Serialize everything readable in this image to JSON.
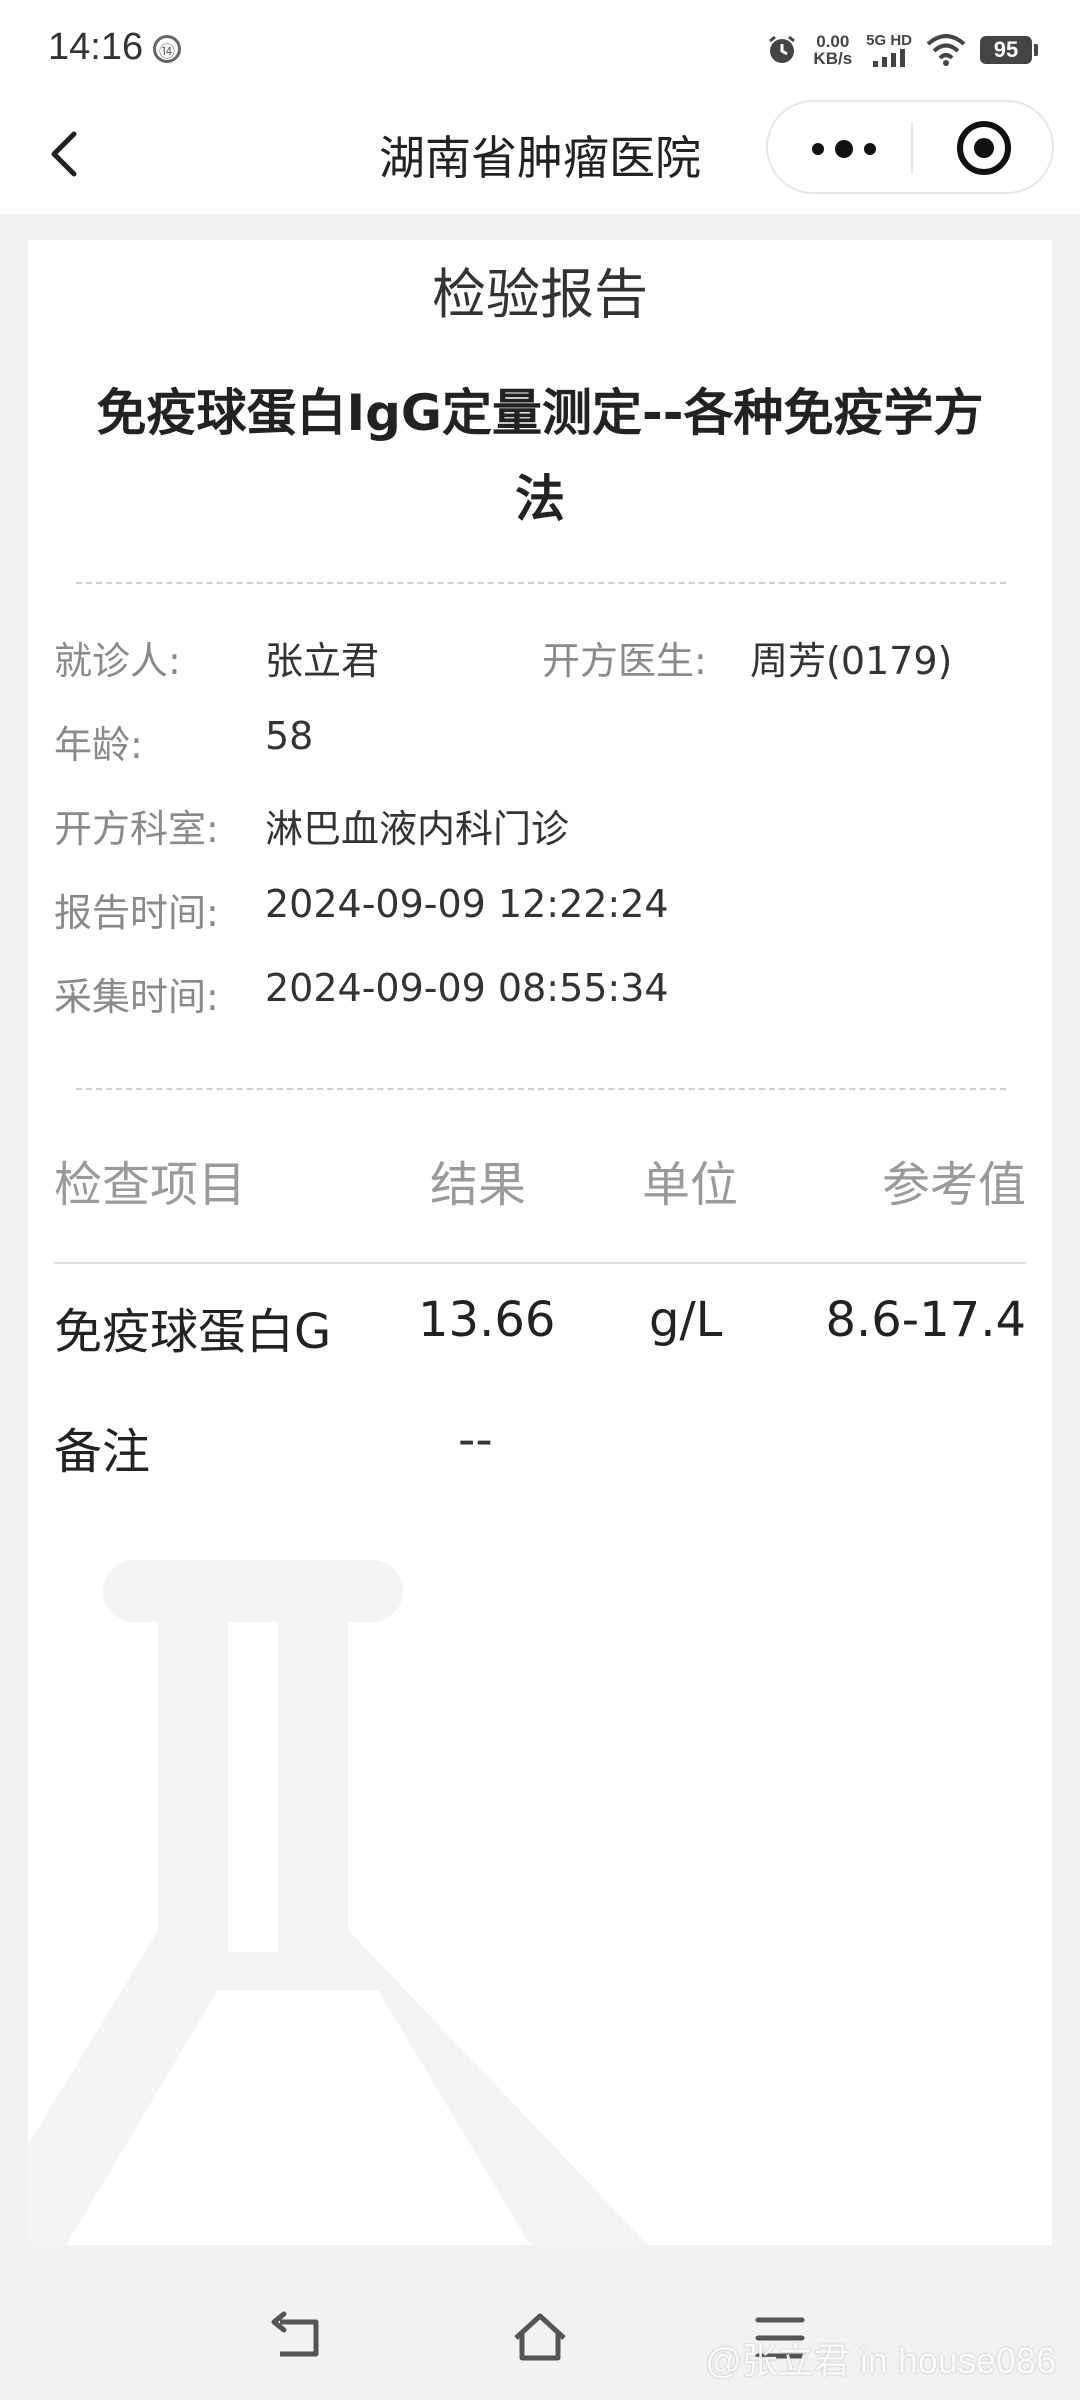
{
  "status_bar": {
    "time": "14:16",
    "badge": "⑭",
    "net_speed": "0.00",
    "net_unit": "KB/s",
    "signal_label": "5G HD",
    "battery": "95"
  },
  "nav": {
    "title": "湖南省肿瘤医院"
  },
  "report": {
    "heading": "检验报告",
    "test_name": "免疫球蛋白IgG定量测定--各种免疫学方法"
  },
  "patient": {
    "name_label": "就诊人:",
    "name": "张立君",
    "doctor_label": "开方医生:",
    "doctor": "周芳(0179)",
    "age_label": "年龄:",
    "age": "58",
    "dept_label": "开方科室:",
    "dept": "淋巴血液内科门诊",
    "report_time_label": "报告时间:",
    "report_time": "2024-09-09 12:22:24",
    "collect_time_label": "采集时间:",
    "collect_time": "2024-09-09 08:55:34"
  },
  "results": {
    "headers": [
      "检查项目",
      "结果",
      "单位",
      "参考值"
    ],
    "rows": [
      {
        "item": "免疫球蛋白G",
        "result": "13.66",
        "unit": "g/L",
        "reference": "8.6-17.4"
      }
    ],
    "remark_label": "备注",
    "remark_value": "--"
  },
  "footer": {
    "watermark": "@张立君 in house086"
  },
  "icons": {
    "back": "chevron-left-icon",
    "more": "more-dots-icon",
    "close": "target-circle-icon",
    "sys_back": "back-arrow-icon",
    "sys_home": "home-icon",
    "sys_menu": "menu-icon",
    "watermark": "flask-icon"
  },
  "colors": {
    "background": "#f2f2f2",
    "card": "#ffffff",
    "label": "#8a8a8a",
    "header": "#9a9a9a"
  }
}
